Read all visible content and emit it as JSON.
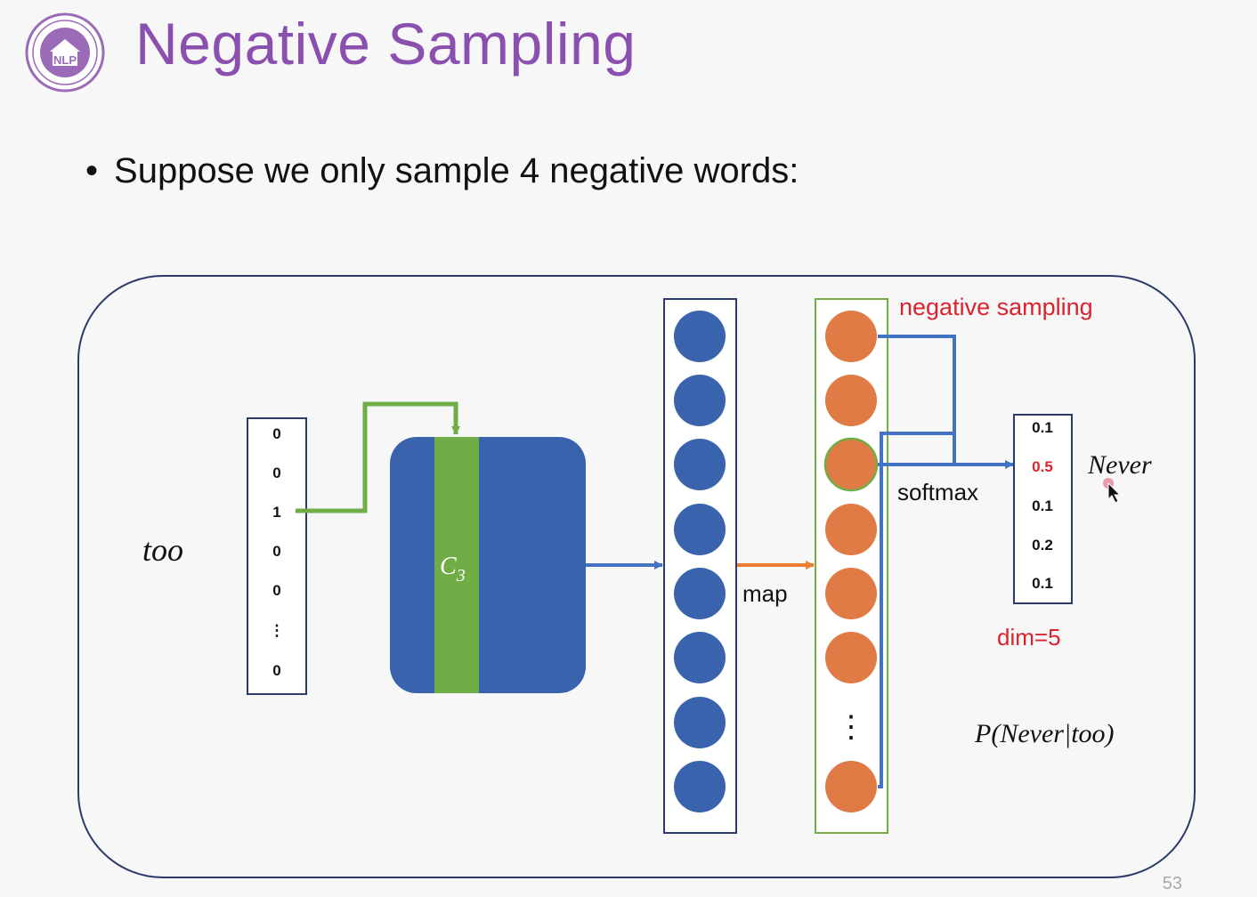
{
  "slide": {
    "title": "Negative Sampling",
    "bullet": "Suppose we only sample 4 negative words:",
    "page_number": "53",
    "logo_text": "NLP"
  },
  "diagram": {
    "input_word": "too",
    "one_hot_vector": [
      "0",
      "0",
      "1",
      "0",
      "0",
      "⋮",
      "0"
    ],
    "matrix_column_label": "C",
    "matrix_column_subscript": "3",
    "map_label": "map",
    "negative_sampling_label": "negative sampling",
    "softmax_label": "softmax",
    "output_vector": [
      "0.1",
      "0.5",
      "0.1",
      "0.2",
      "0.1"
    ],
    "output_word": "Never",
    "dim_label": "dim=5",
    "probability_label": "P(Never|too)",
    "ellipsis": "⋮"
  },
  "colors": {
    "title": "#8b4fb0",
    "blue_node": "#3a63ad",
    "orange_node": "#e07b45",
    "green_highlight": "#71ad47",
    "arrow_blue": "#4472c4",
    "arrow_orange": "#ed7d31",
    "accent_red": "#d9232e",
    "frame": "#2b3a6a"
  }
}
